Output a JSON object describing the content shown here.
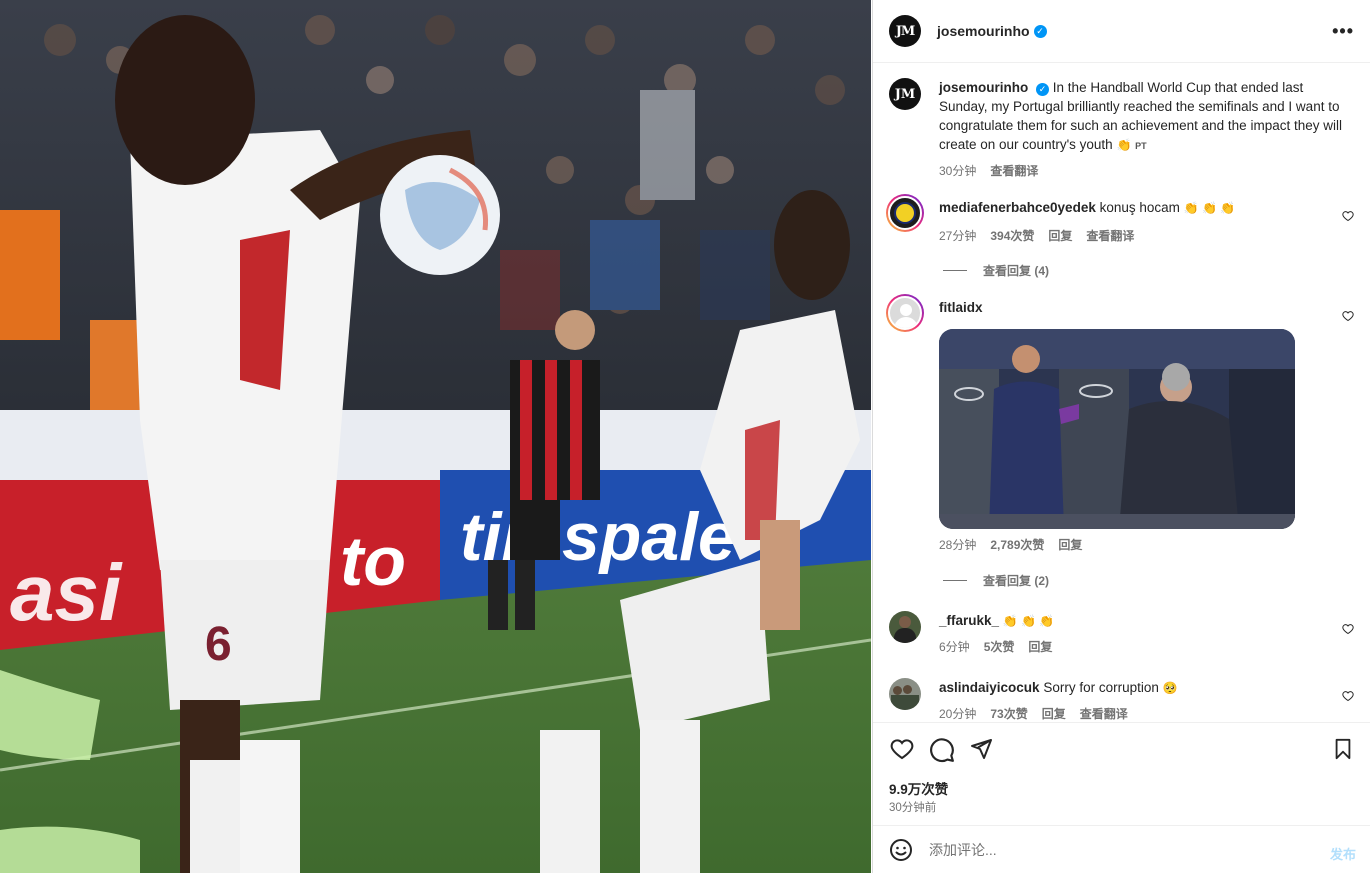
{
  "header": {
    "username": "josemourinho",
    "avatar_initials": "JM",
    "more_icon": "more-horizontal-icon"
  },
  "caption": {
    "username": "josemourinho",
    "text": "In the Handball World Cup that ended last Sunday, my Portugal brilliantly reached the semifinals and I want to congratulate them for such an achievement and the impact they will create on our country's youth",
    "emoji": "👏",
    "flag": "PT",
    "time": "30分钟",
    "translate": "查看翻译"
  },
  "comments": [
    {
      "username": "mediafenerbahce0yedek",
      "text": "konuş hocam",
      "emoji": "👏 👏 👏",
      "time": "27分钟",
      "likes": "394次赞",
      "reply": "回复",
      "translate": "查看翻译",
      "view_replies": "查看回复 (4)"
    },
    {
      "username": "fitlaidx",
      "text": "",
      "time": "28分钟",
      "likes": "2,789次赞",
      "reply": "回复",
      "view_replies": "查看回复 (2)"
    },
    {
      "username": "_ffarukk_",
      "text": "",
      "emoji": "👏 👏 👏",
      "time": "6分钟",
      "likes": "5次赞",
      "reply": "回复"
    },
    {
      "username": "aslindaiyicocuk",
      "text": "Sorry for corruption",
      "emoji": "🥺",
      "time": "20分钟",
      "likes": "73次赞",
      "reply": "回复",
      "translate": "查看翻译"
    }
  ],
  "actions": {
    "likes": "9.9万次赞",
    "time": "30分钟前"
  },
  "comment_input": {
    "placeholder": "添加评论...",
    "post": "发布"
  },
  "colors": {
    "verified": "#0095f6",
    "text_secondary": "#737373",
    "post_button_disabled": "#b2dffc"
  }
}
